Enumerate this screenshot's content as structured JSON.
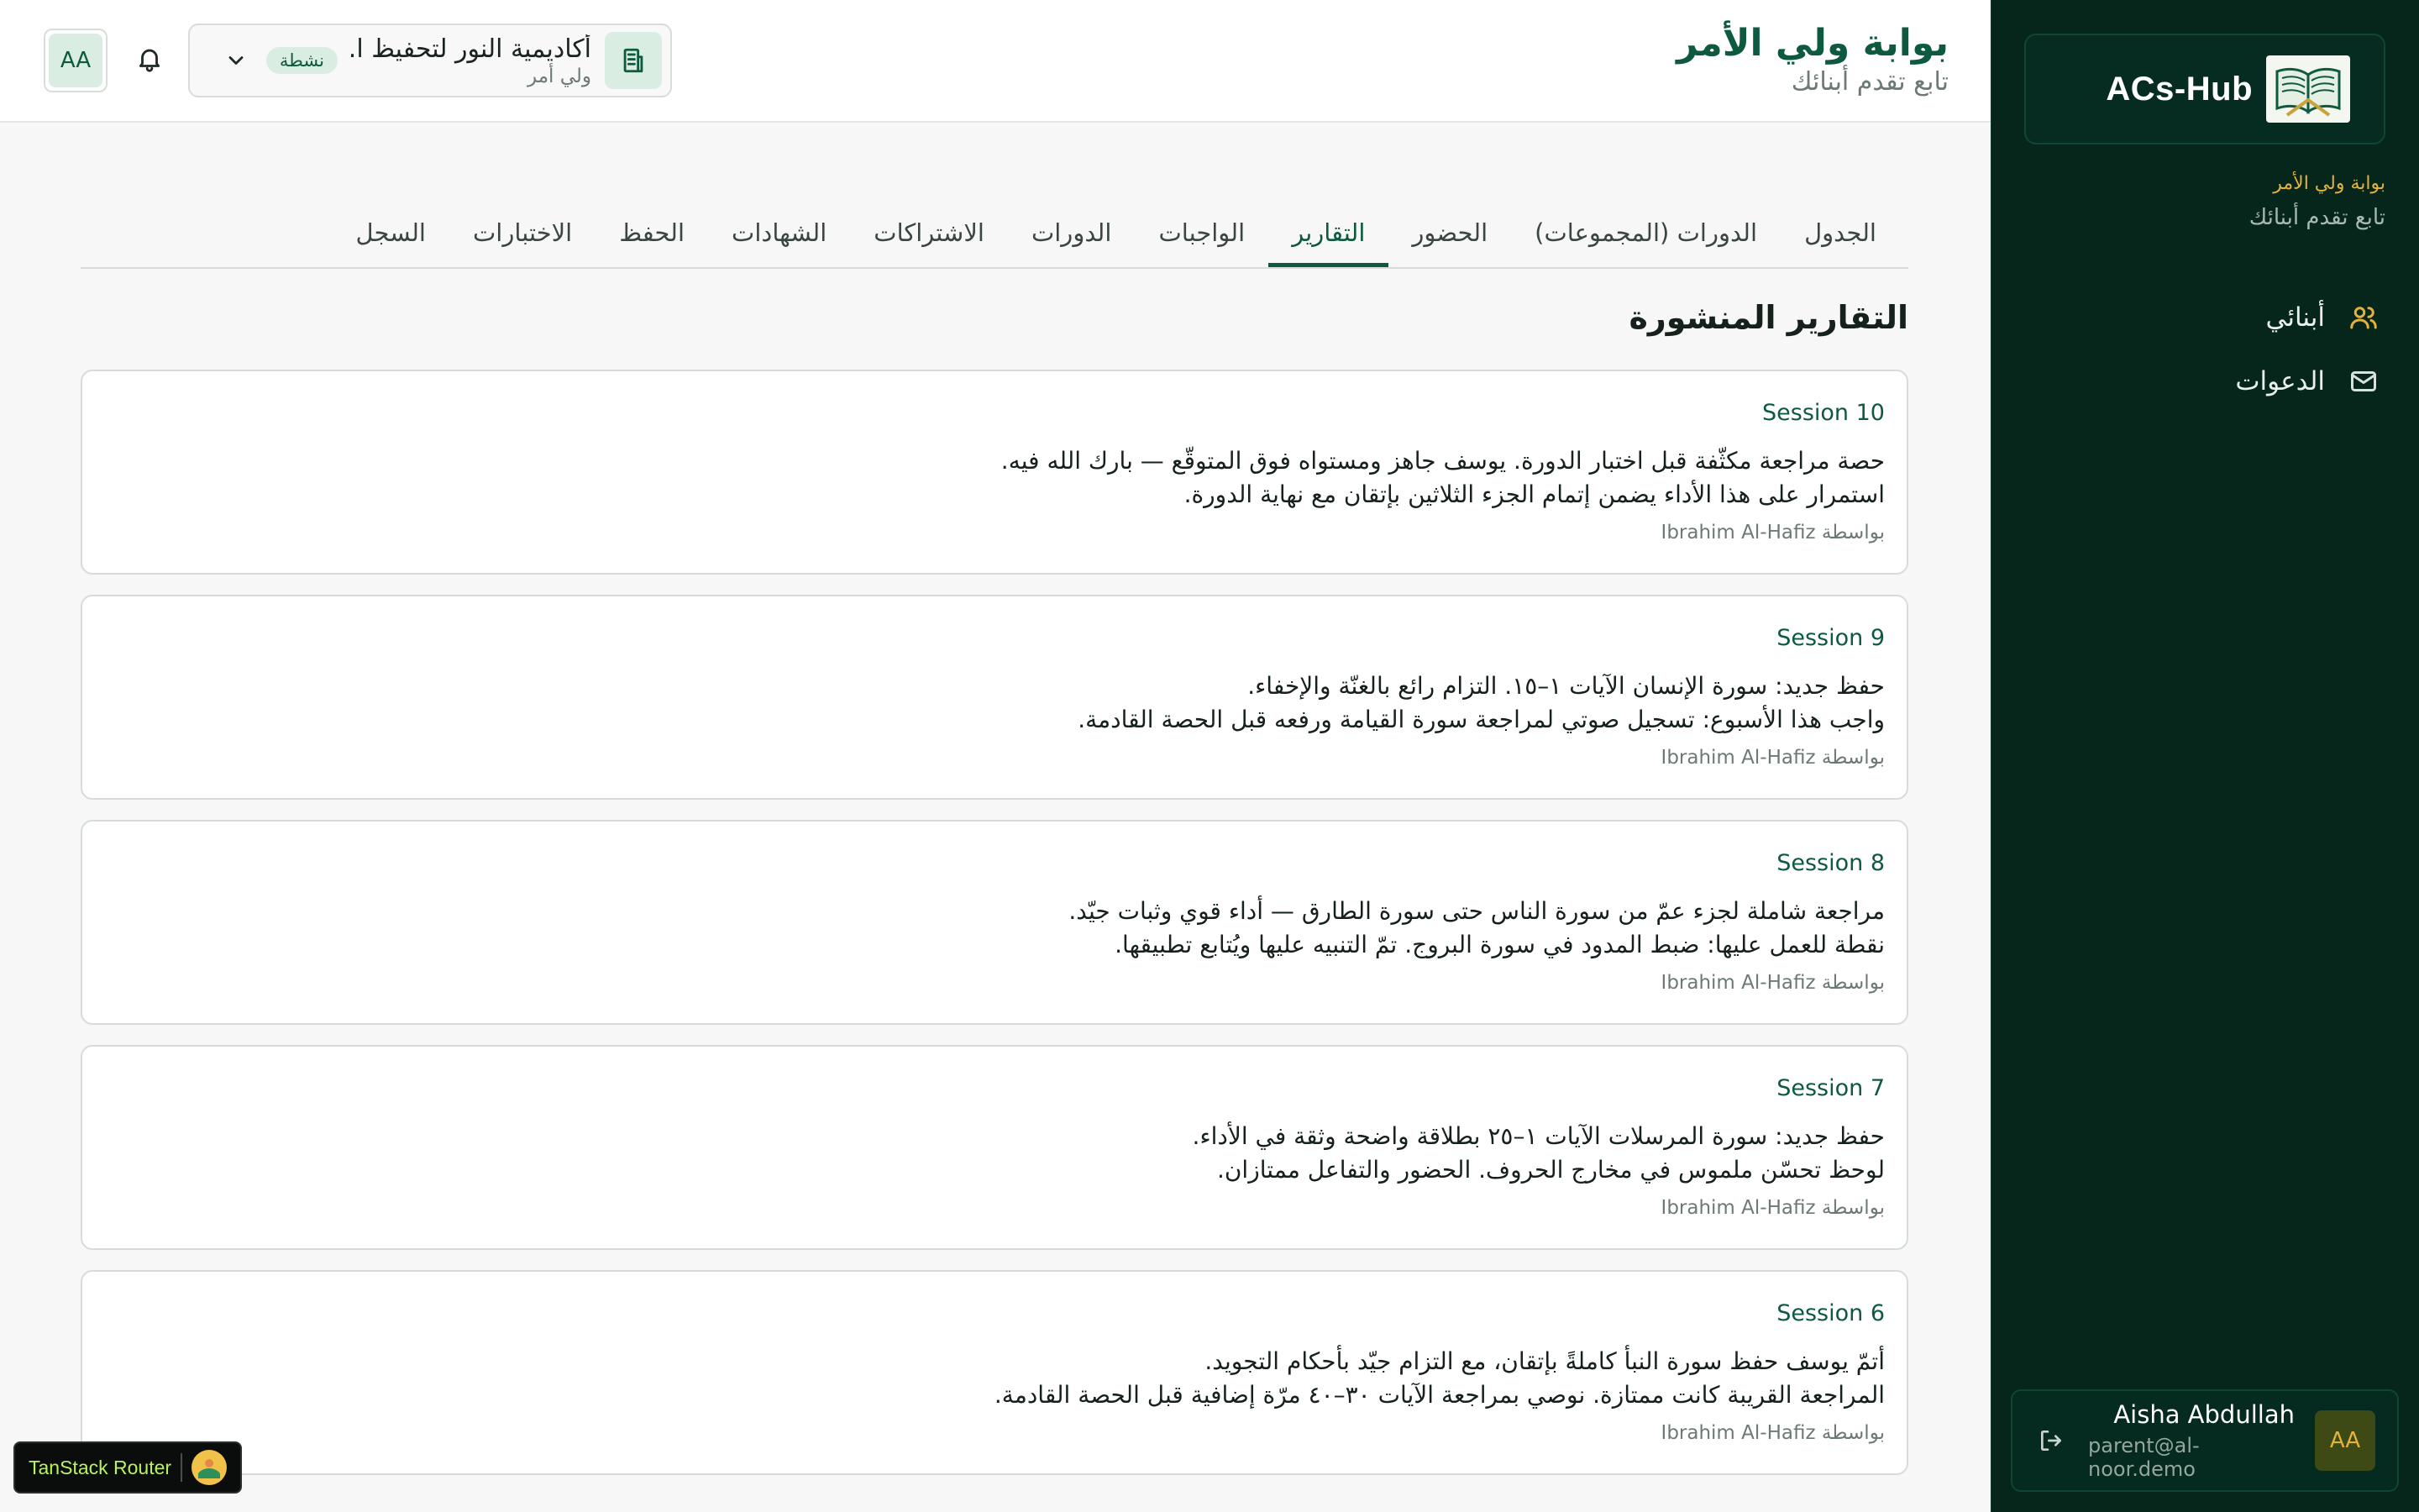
{
  "sidebar": {
    "brand": "ACs-Hub",
    "eyebrow": "بوابة ولي الأمر",
    "subtitle": "تابع تقدم أبنائك",
    "items": [
      {
        "label": "أبنائي",
        "icon": "users-icon",
        "active": true
      },
      {
        "label": "الدعوات",
        "icon": "mail-icon",
        "active": false
      }
    ],
    "user": {
      "initials": "AA",
      "name": "Aisha Abdullah",
      "email": "parent@al-noor.demo"
    }
  },
  "header": {
    "title": "بوابة ولي الأمر",
    "subtitle": "تابع تقدم أبنائك",
    "avatar_initials": "AA",
    "org": {
      "name": "أكاديمية النور لتحفيظ ا...",
      "role": "ولي أمر",
      "status": "نشطة"
    }
  },
  "tabs": [
    {
      "label": "الجدول"
    },
    {
      "label": "الدورات (المجموعات)"
    },
    {
      "label": "الحضور"
    },
    {
      "label": "التقارير"
    },
    {
      "label": "الواجبات"
    },
    {
      "label": "الدورات"
    },
    {
      "label": "الاشتراكات"
    },
    {
      "label": "الشهادات"
    },
    {
      "label": "الحفظ"
    },
    {
      "label": "الاختبارات"
    },
    {
      "label": "السجل"
    }
  ],
  "active_tab": "التقارير",
  "section_title": "التقارير المنشورة",
  "reports": [
    {
      "title": "Session 10",
      "line1": "حصة مراجعة مكثّفة قبل اختبار الدورة. يوسف جاهز ومستواه فوق المتوقّع — بارك الله فيه.",
      "line2": "استمرار على هذا الأداء يضمن إتمام الجزء الثلاثين بإتقان مع نهاية الدورة.",
      "by": "بواسطة Ibrahim Al-Hafiz"
    },
    {
      "title": "Session 9",
      "line1": "حفظ جديد: سورة الإنسان الآيات ١–١٥. التزام رائع بالغنّة والإخفاء.",
      "line2": "واجب هذا الأسبوع: تسجيل صوتي لمراجعة سورة القيامة ورفعه قبل الحصة القادمة.",
      "by": "بواسطة Ibrahim Al-Hafiz"
    },
    {
      "title": "Session 8",
      "line1": "مراجعة شاملة لجزء عمّ من سورة الناس حتى سورة الطارق — أداء قوي وثبات جيّد.",
      "line2": "نقطة للعمل عليها: ضبط المدود في سورة البروج. تمّ التنبيه عليها ويُتابع تطبيقها.",
      "by": "بواسطة Ibrahim Al-Hafiz"
    },
    {
      "title": "Session 7",
      "line1": "حفظ جديد: سورة المرسلات الآيات ١–٢٥ بطلاقة واضحة وثقة في الأداء.",
      "line2": "لوحظ تحسّن ملموس في مخارج الحروف. الحضور والتفاعل ممتازان.",
      "by": "بواسطة Ibrahim Al-Hafiz"
    },
    {
      "title": "Session 6",
      "line1": "أتمّ يوسف حفظ سورة النبأ كاملةً بإتقان، مع التزام جيّد بأحكام التجويد.",
      "line2": "المراجعة القريبة كانت ممتازة. نوصي بمراجعة الآيات ٣٠–٤٠ مرّة إضافية قبل الحصة القادمة.",
      "by": "بواسطة Ibrahim Al-Hafiz"
    }
  ],
  "devtools": {
    "label": "TanStack Router"
  }
}
